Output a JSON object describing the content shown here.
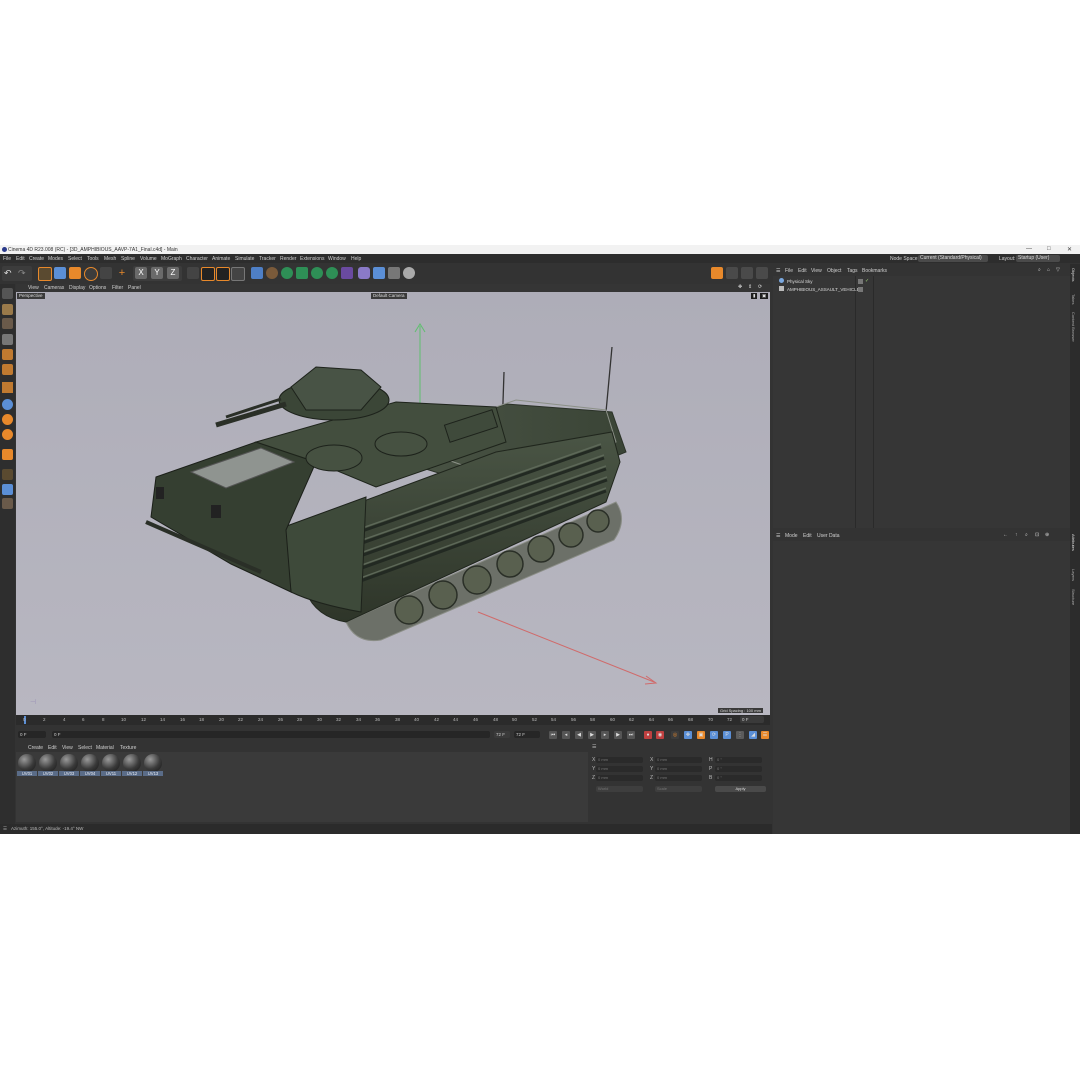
{
  "window": {
    "title": "Cinema 4D R23.008 (RC) - [3D_AMPHIBIOUS_AAVP-7A1_Final.c4d] - Main",
    "controls": [
      "—",
      "□",
      "✕"
    ]
  },
  "menubar": {
    "items": [
      "File",
      "Edit",
      "Create",
      "Modes",
      "Select",
      "Tools",
      "Mesh",
      "Spline",
      "Volume",
      "MoGraph",
      "Character",
      "Animate",
      "Simulate",
      "Tracker",
      "Render",
      "Extensions",
      "Window",
      "Help"
    ],
    "node_space_label": "Node Space:",
    "node_space_value": "Current (Standard/Physical)",
    "layout_label": "Layout:",
    "layout_value": "Startup (User)"
  },
  "viewport": {
    "menu": [
      "View",
      "Cameras",
      "Display",
      "Options",
      "Filter",
      "Panel"
    ],
    "view_name": "Perspective",
    "camera_name": "Default Camera",
    "grid_spacing": "Grid Spacing : 100 mm"
  },
  "timeline": {
    "ticks": [
      "0",
      "2",
      "4",
      "6",
      "8",
      "10",
      "12",
      "14",
      "16",
      "18",
      "20",
      "22",
      "24",
      "26",
      "28",
      "30",
      "32",
      "34",
      "36",
      "38",
      "40",
      "42",
      "44",
      "46",
      "48",
      "50",
      "52",
      "54",
      "56",
      "58",
      "60",
      "62",
      "64",
      "66",
      "68",
      "70",
      "72"
    ],
    "current_frame": "0 F"
  },
  "playback": {
    "start_field": "0 F",
    "min_field": "0 F",
    "max_field": "72 F",
    "end_field": "72 F"
  },
  "materials": {
    "menu": [
      "Create",
      "Edit",
      "View",
      "Select",
      "Material",
      "Texture"
    ],
    "items": [
      "UV01",
      "UV02",
      "UV03",
      "UV04",
      "UV11",
      "UV12",
      "UV13"
    ]
  },
  "coordinates": {
    "rows": [
      {
        "pos_axis": "X",
        "pos_value": "0 mm",
        "size_axis": "X",
        "size_value": "0 mm",
        "rot_axis": "H",
        "rot_value": "0 °"
      },
      {
        "pos_axis": "Y",
        "pos_value": "0 mm",
        "size_axis": "Y",
        "size_value": "0 mm",
        "rot_axis": "P",
        "rot_value": "0 °"
      },
      {
        "pos_axis": "Z",
        "pos_value": "0 mm",
        "size_axis": "Z",
        "size_value": "0 mm",
        "rot_axis": "B",
        "rot_value": "0 °"
      }
    ],
    "mode_select": "World",
    "scale_select": "Scale",
    "apply_label": "Apply"
  },
  "status": {
    "text": "Azimuth: 155.0°, Altitude: -19.4°  NW"
  },
  "objects_panel": {
    "menu": [
      "File",
      "Edit",
      "View",
      "Object",
      "Tags",
      "Bookmarks"
    ],
    "items": [
      "Physical Sky",
      "AMPHIBIOUS_ASSAULT_VEHICLE"
    ]
  },
  "attributes_panel": {
    "menu": [
      "Mode",
      "Edit",
      "User Data"
    ]
  },
  "right_tabs": [
    "Objects",
    "Takes",
    "Content Browser",
    "Attributes",
    "Layers",
    "Structure"
  ],
  "colors": {
    "accent_orange": "#e8892b",
    "accent_blue": "#5b8fd6",
    "material_label": "#5a6c88",
    "viewport_bg": "#b2b1bc",
    "vehicle_green": "#3e4a3a"
  }
}
